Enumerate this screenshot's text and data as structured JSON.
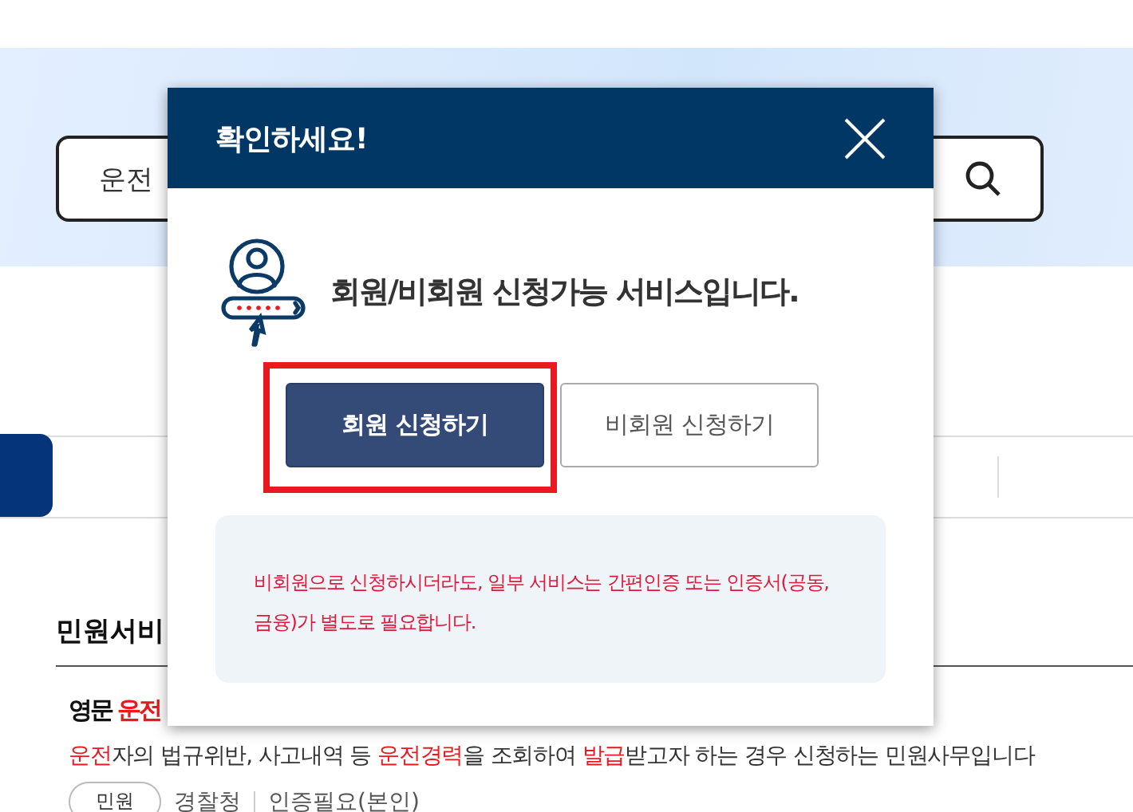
{
  "search": {
    "value": "운전"
  },
  "section": {
    "title": "민원서비"
  },
  "service": {
    "title": [
      {
        "text": "영문 ",
        "highlight": false
      },
      {
        "text": "운전",
        "highlight": true
      }
    ],
    "description": [
      {
        "text": "운전",
        "highlight": true
      },
      {
        "text": "자의 법규위반, 사고내역 등 ",
        "highlight": false
      },
      {
        "text": "운전경력",
        "highlight": true
      },
      {
        "text": "을 조회하여 ",
        "highlight": false
      },
      {
        "text": "발급",
        "highlight": true
      },
      {
        "text": "받고자 하는 경우 신청하는 민원사무입니다",
        "highlight": false
      }
    ],
    "category": "민원",
    "agency": "경찰청",
    "auth": "인증필요(본인)"
  },
  "dialog": {
    "title": "확인하세요!",
    "message": "회원/비회원 신청가능 서비스입니다.",
    "buttons": [
      {
        "label": "회원 신청하기",
        "kind": "primary",
        "highlighted": true
      },
      {
        "label": "비회원 신청하기",
        "kind": "secondary",
        "highlighted": false
      }
    ],
    "notice": "비회원으로 신청하시더라도, 일부 서비스는 간편인증 또는 인증서(공동, 금융)가 별도로 필요합니다."
  }
}
